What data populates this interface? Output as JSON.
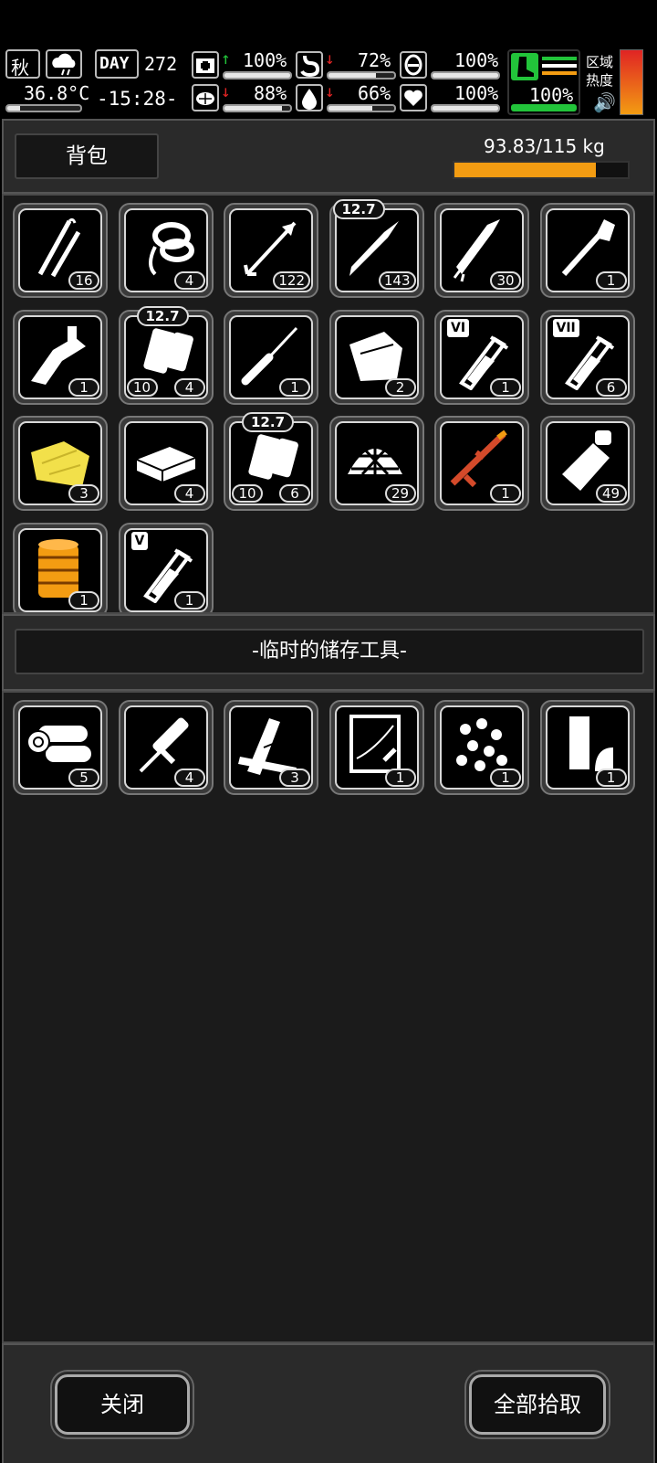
{
  "hud": {
    "season": "秋",
    "day_label": "DAY",
    "day": "272",
    "time": "-15:28-",
    "temperature": "36.8°C",
    "stats_row1": [
      {
        "name": "health",
        "value": "100%",
        "trend": "up",
        "level": 1.0
      },
      {
        "name": "stomach",
        "value": "72%",
        "trend": "down",
        "level": 0.72
      },
      {
        "name": "mood",
        "value": "100%",
        "trend": "none",
        "level": 1.0
      }
    ],
    "stats_row2": [
      {
        "name": "brain",
        "value": "88%",
        "trend": "down",
        "level": 0.88
      },
      {
        "name": "water",
        "value": "66%",
        "trend": "down",
        "level": 0.66
      },
      {
        "name": "heart",
        "value": "100%",
        "trend": "none",
        "level": 1.0
      }
    ],
    "stamina": {
      "value": "100%",
      "level": 1.0
    },
    "zone_heat_label": "区域热度",
    "colors": {
      "green": "#22c43a",
      "red": "#e02424",
      "orange": "#f39c12"
    }
  },
  "backpack": {
    "title": "背包",
    "weight": "93.83/115 kg",
    "fill": 0.816,
    "items": [
      {
        "icon": "lockpick-icon",
        "count": "16"
      },
      {
        "icon": "rope-icon",
        "count": "4"
      },
      {
        "icon": "arrow-icon",
        "count": "122"
      },
      {
        "icon": "bullet-icon",
        "count": "143",
        "caliber": "12.7"
      },
      {
        "icon": "rocket-icon",
        "count": "30"
      },
      {
        "icon": "shovel-icon",
        "count": "1"
      },
      {
        "icon": "multitool-icon",
        "count": "1"
      },
      {
        "icon": "magazine-icon",
        "count": "4",
        "left_count": "10",
        "caliber": "12.7"
      },
      {
        "icon": "screwdriver-icon",
        "count": "1"
      },
      {
        "icon": "cloth-icon",
        "count": "2"
      },
      {
        "icon": "test-tube-icon",
        "count": "1",
        "roman": "VI"
      },
      {
        "icon": "test-tube-icon",
        "count": "6",
        "roman": "VII"
      },
      {
        "icon": "yellow-tarp-icon",
        "count": "3"
      },
      {
        "icon": "box-icon",
        "count": "4"
      },
      {
        "icon": "magazine-icon",
        "count": "6",
        "left_count": "10",
        "caliber": "12.7"
      },
      {
        "icon": "net-icon",
        "count": "29"
      },
      {
        "icon": "rifle-icon",
        "count": "1"
      },
      {
        "icon": "sleeping-bag-icon",
        "count": "49"
      },
      {
        "icon": "spool-icon",
        "count": "1"
      },
      {
        "icon": "test-tube-icon",
        "count": "1",
        "roman": "V"
      }
    ]
  },
  "storage": {
    "title": "-临时的储存工具-",
    "items": [
      {
        "icon": "logs-icon",
        "count": "5"
      },
      {
        "icon": "rasp-icon",
        "count": "4"
      },
      {
        "icon": "planks-icon",
        "count": "3"
      },
      {
        "icon": "blueprint-icon",
        "count": "1"
      },
      {
        "icon": "pearls-icon",
        "count": "1"
      },
      {
        "icon": "scrap-icon",
        "count": "1"
      }
    ]
  },
  "buttons": {
    "close": "关闭",
    "take_all": "全部拾取"
  }
}
